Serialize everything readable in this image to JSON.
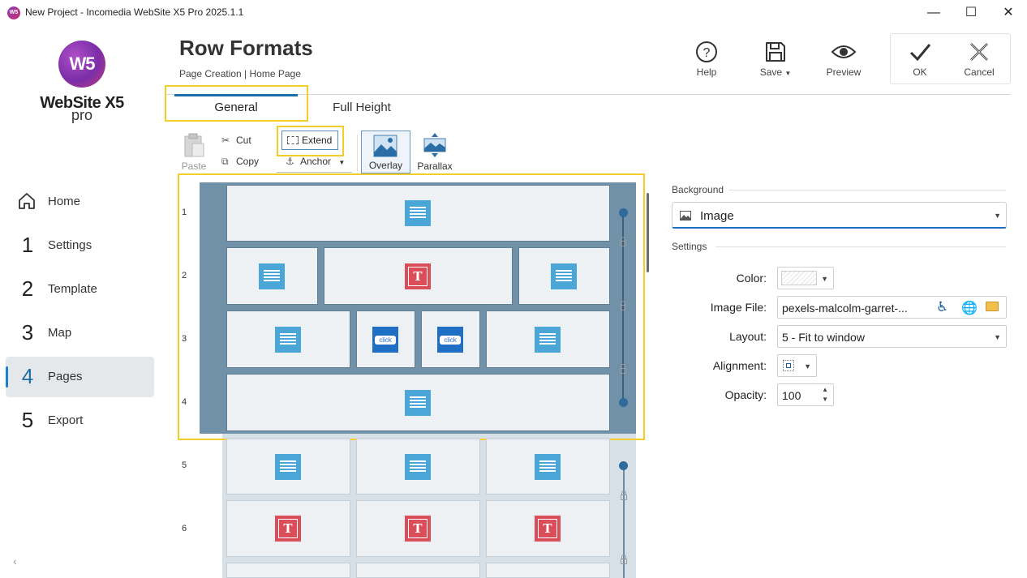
{
  "window": {
    "title": "New Project - Incomedia WebSite X5 Pro 2025.1.1",
    "app_icon": "W5",
    "minimize": "—",
    "maximize": "☐",
    "close": "✕"
  },
  "logo": {
    "mark": "W5",
    "name": "WebSite X5",
    "edition": "pro"
  },
  "nav": [
    {
      "num": "",
      "label": "Home",
      "icon": "home-icon"
    },
    {
      "num": "1",
      "label": "Settings"
    },
    {
      "num": "2",
      "label": "Template"
    },
    {
      "num": "3",
      "label": "Map"
    },
    {
      "num": "4",
      "label": "Pages",
      "active": true
    },
    {
      "num": "5",
      "label": "Export"
    }
  ],
  "header": {
    "title": "Row Formats",
    "breadcrumb": "Page Creation | Home Page"
  },
  "toolbar": {
    "help": "Help",
    "save": "Save",
    "preview": "Preview",
    "ok": "OK",
    "cancel": "Cancel"
  },
  "tabs": [
    {
      "label": "General",
      "active": true
    },
    {
      "label": "Full Height"
    }
  ],
  "ribbon": {
    "paste": "Paste",
    "cut": "Cut",
    "copy": "Copy",
    "extend": "Extend",
    "anchor": "Anchor",
    "overlay": "Overlay",
    "parallax": "Parallax"
  },
  "grid": {
    "rows": [
      "1",
      "2",
      "3",
      "4",
      "5",
      "6"
    ],
    "click_label": "click"
  },
  "panel": {
    "background_section": "Background",
    "background_value": "Image",
    "settings_section": "Settings",
    "color_label": "Color:",
    "image_file_label": "Image File:",
    "image_file_value": "pexels-malcolm-garret-...",
    "layout_label": "Layout:",
    "layout_value": "5 - Fit to window",
    "alignment_label": "Alignment:",
    "opacity_label": "Opacity:",
    "opacity_value": "100"
  },
  "colors": {
    "accent": "#1f6fc4",
    "highlight": "#f5cd2a",
    "selection": "#7191a8"
  }
}
